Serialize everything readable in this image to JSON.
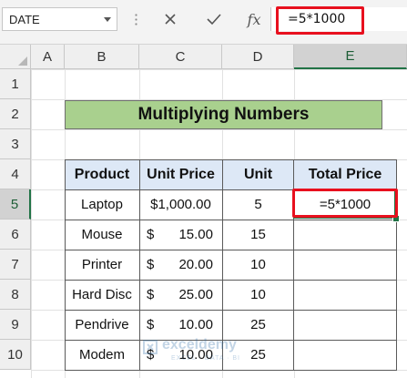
{
  "formula_bar": {
    "name_box": "DATE",
    "cancel_icon": "close-icon",
    "enter_icon": "check-icon",
    "fx_label": "fx",
    "formula": "=5*1000"
  },
  "columns": [
    "A",
    "B",
    "C",
    "D",
    "E"
  ],
  "selected_column": "E",
  "rows": [
    "1",
    "2",
    "3",
    "4",
    "5",
    "6",
    "7",
    "8",
    "9",
    "10"
  ],
  "selected_row": "5",
  "title": "Multiplying Numbers",
  "table": {
    "headers": [
      "Product",
      "Unit Price",
      "Unit",
      "Total Price"
    ],
    "rows": [
      {
        "product": "Laptop",
        "currency": "$1,000.00",
        "amount": "",
        "unit": "5",
        "total": "=5*1000"
      },
      {
        "product": "Mouse",
        "currency": "$",
        "amount": "15.00",
        "unit": "15",
        "total": ""
      },
      {
        "product": "Printer",
        "currency": "$",
        "amount": "20.00",
        "unit": "10",
        "total": ""
      },
      {
        "product": "Hard Disc",
        "currency": "$",
        "amount": "25.00",
        "unit": "10",
        "total": ""
      },
      {
        "product": "Pendrive",
        "currency": "$",
        "amount": "10.00",
        "unit": "25",
        "total": ""
      },
      {
        "product": "Modem",
        "currency": "$",
        "amount": "10.00",
        "unit": "25",
        "total": ""
      }
    ]
  },
  "watermark": {
    "name": "exceldemy",
    "tagline": "EXCEL · DATA · BI"
  },
  "colors": {
    "accent": "#217346",
    "highlight": "#e8101e",
    "title_fill": "#a9d08e",
    "header_fill": "#dde8f6"
  }
}
